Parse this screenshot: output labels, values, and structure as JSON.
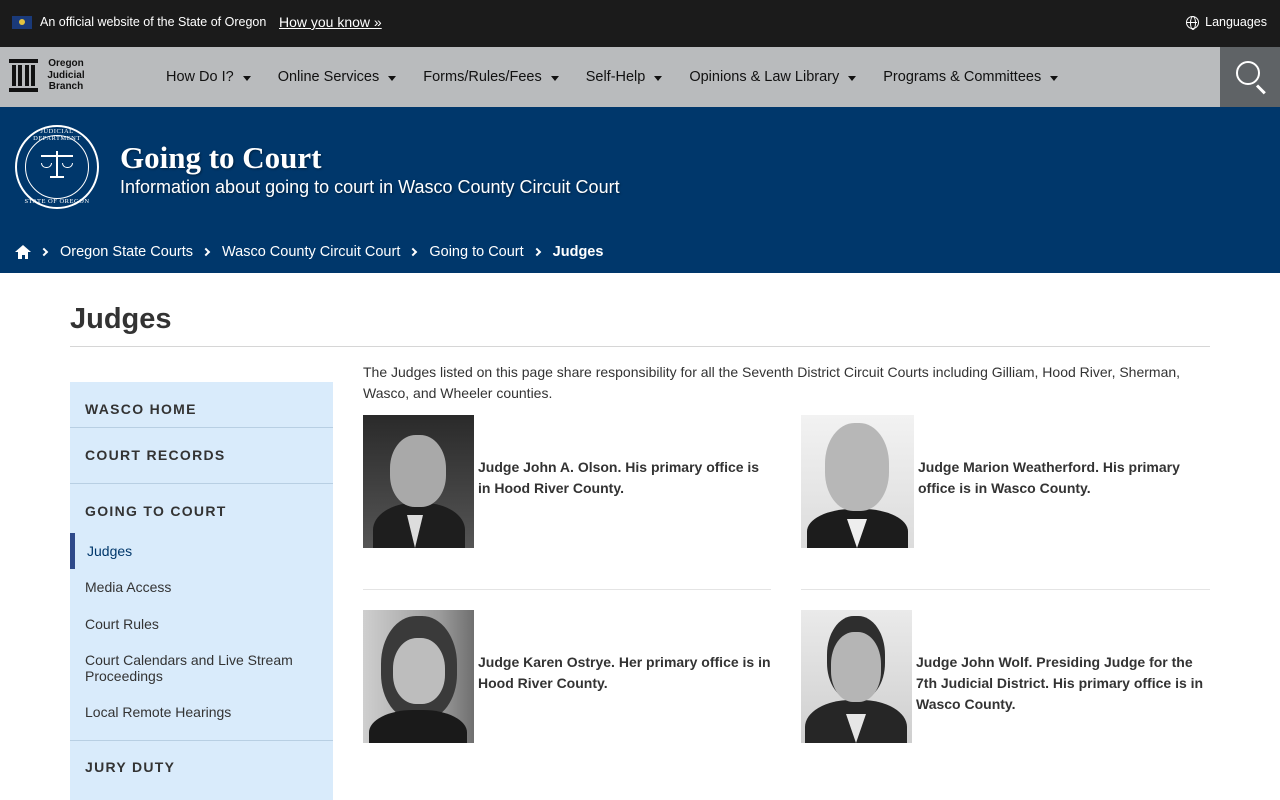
{
  "official_bar": {
    "site_text": "An official website of the State of Oregon",
    "how_you_know": "How you know »",
    "languages": "Languages"
  },
  "navbar": {
    "logo_lines": [
      "Oregon",
      "Judicial",
      "Branch"
    ],
    "menu": [
      {
        "label": "How Do I?"
      },
      {
        "label": "Online Services"
      },
      {
        "label": "Forms/Rules/Fees"
      },
      {
        "label": "Self-Help"
      },
      {
        "label": "Opinions & Law Library"
      },
      {
        "label": "Programs & Committees"
      }
    ]
  },
  "hero": {
    "seal_top": "JUDICIAL DEPARTMENT",
    "seal_bottom": "STATE OF OREGON",
    "title": "Going to Court",
    "subtitle": "Information about going to court in Wasco County Circuit Court"
  },
  "breadcrumb": [
    "Oregon State Courts",
    "Wasco County Circuit Court",
    "Going to Court",
    "Judges"
  ],
  "page": {
    "title": "Judges",
    "intro": "The Judges listed on this page share responsibility for all the Seventh District Circuit Courts including Gilliam, Hood River, Sherman, Wasco, and Wheeler counties."
  },
  "sidebar": {
    "sections": [
      "WASCO HOME",
      "COURT RECORDS",
      "GOING TO COURT",
      "JURY DUTY"
    ],
    "links": [
      "Judges",
      "Media Access",
      "Court Rules",
      "Court Calendars and Live Stream Proceedings",
      "Local Remote Hearings"
    ]
  },
  "judges": [
    {
      "text": "Judge John A. Olson. His primary office is in Hood River County."
    },
    {
      "text": "Judge Marion Weatherford. His primary office is in Wasco County."
    },
    {
      "text": "Judge Karen Ostrye. Her primary office is in Hood River County."
    },
    {
      "text": "Judge John Wolf. Presiding Judge for the 7th Judicial District. His primary office is in Wasco County."
    }
  ],
  "colors": {
    "top_bar": "#1b1b1b",
    "nav_bar": "#b9bbbd",
    "hero": "#00376b",
    "sidebar": "#d9ebfb",
    "active_link_bar": "#2f4a8a"
  }
}
